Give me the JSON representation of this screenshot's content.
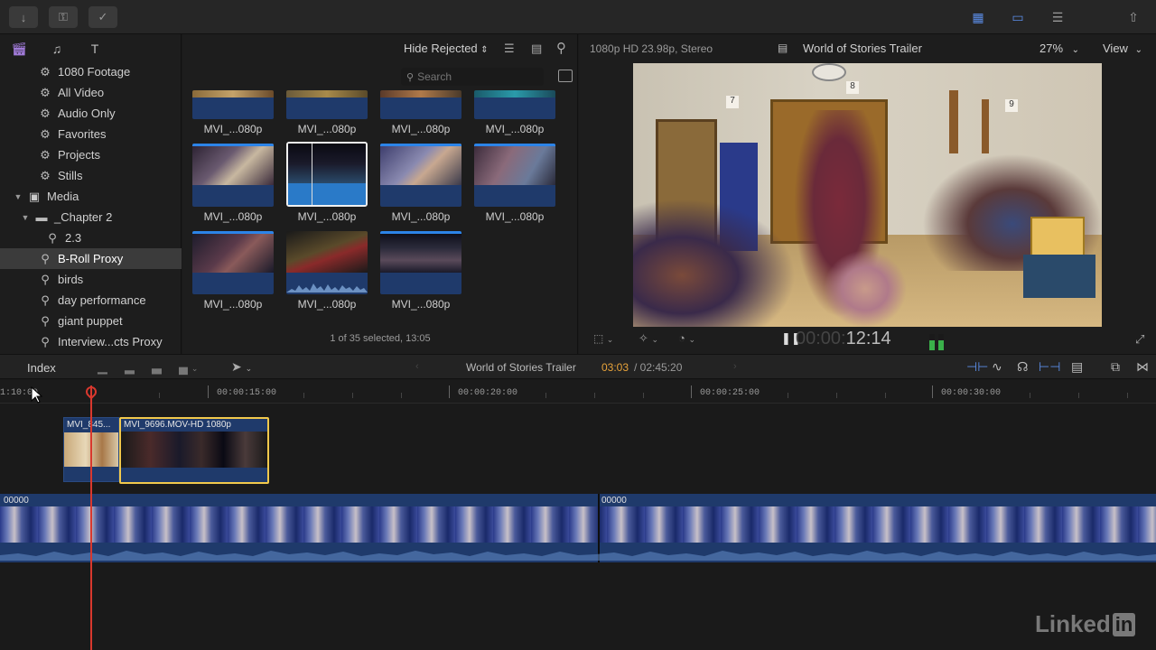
{
  "browser": {
    "filter_label": "Hide Rejected",
    "search_placeholder": "Search",
    "status": "1 of 35 selected, 13:05",
    "clip_labels": [
      "MVI_...080p",
      "MVI_...080p",
      "MVI_...080p",
      "MVI_...080p",
      "MVI_...080p",
      "MVI_...080p",
      "MVI_...080p",
      "MVI_...080p",
      "MVI_...080p",
      "MVI_...080p",
      "MVI_...080p"
    ]
  },
  "sidebar": {
    "items": [
      {
        "label": "1080 Footage",
        "icon": "gear-icon"
      },
      {
        "label": "All Video",
        "icon": "gear-icon"
      },
      {
        "label": "Audio Only",
        "icon": "gear-icon"
      },
      {
        "label": "Favorites",
        "icon": "gear-icon"
      },
      {
        "label": "Projects",
        "icon": "gear-icon"
      },
      {
        "label": "Stills",
        "icon": "gear-icon"
      },
      {
        "label": "Media",
        "icon": "star-box-icon"
      },
      {
        "label": "_Chapter 2",
        "icon": "folder-icon"
      },
      {
        "label": "2.3",
        "icon": "keyword-icon"
      },
      {
        "label": "B-Roll Proxy",
        "icon": "keyword-icon"
      },
      {
        "label": "birds",
        "icon": "keyword-icon"
      },
      {
        "label": "day performance",
        "icon": "keyword-icon"
      },
      {
        "label": "giant puppet",
        "icon": "keyword-icon"
      },
      {
        "label": "Interview...cts Proxy",
        "icon": "keyword-icon"
      }
    ]
  },
  "viewer": {
    "format": "1080p HD 23.98p, Stereo",
    "project": "World of Stories Trailer",
    "zoom": "27%",
    "view_label": "View",
    "timecode_dim": "00:00:",
    "timecode": "12:14",
    "room_numbers": [
      "7",
      "8",
      "9"
    ]
  },
  "timeline": {
    "index_label": "Index",
    "project": "World of Stories Trailer",
    "current": "03:03",
    "total": "/ 02:45:20",
    "ruler_labels": [
      "1:10:00",
      "00:00:15:00",
      "00:00:20:00",
      "00:00:25:00",
      "00:00:30:00"
    ],
    "connected_clips": [
      "MVI_845...",
      "MVI_9696.MOV-HD 1080p"
    ],
    "primary_labels": [
      "00000",
      "00000"
    ]
  },
  "watermark": "Linked",
  "watermark_in": "in",
  "colors": {
    "accent_blue": "#2c84e8",
    "selection_yellow": "#f2c94c",
    "playhead_red": "#d9382e",
    "timecode_orange": "#e8a33a"
  }
}
